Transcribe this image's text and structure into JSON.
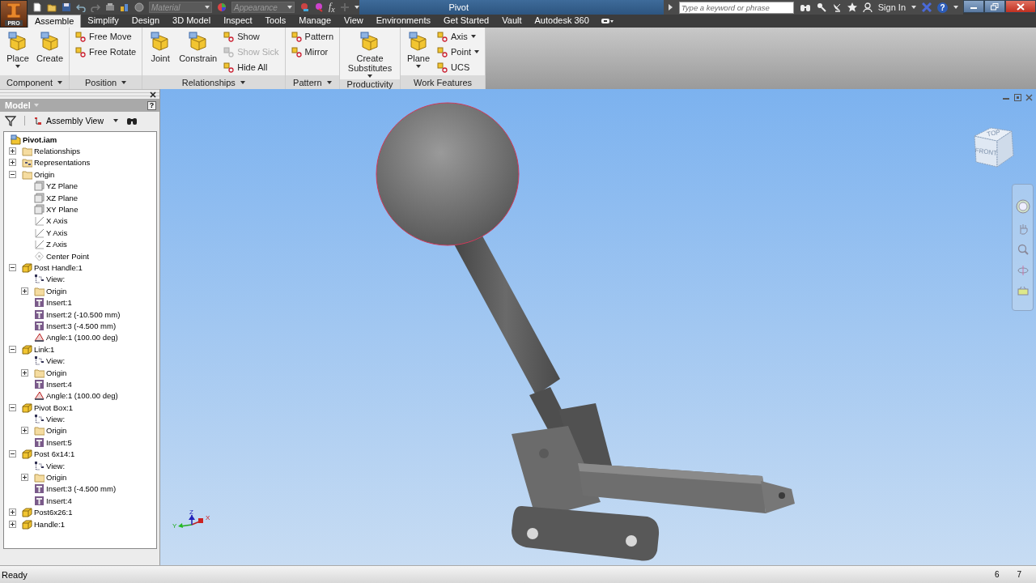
{
  "app": {
    "title": "Pivot",
    "edition": "PRO"
  },
  "quick_access": {
    "material": "Material",
    "appearance": "Appearance",
    "formula": "f$_{x}$"
  },
  "help": {
    "search_placeholder": "Type a keyword or phrase",
    "sign_in": "Sign In",
    "help_label": "?"
  },
  "tabs": [
    {
      "label": "Assemble",
      "selected": true
    },
    {
      "label": "Simplify",
      "selected": false
    },
    {
      "label": "Design",
      "selected": false
    },
    {
      "label": "3D Model",
      "selected": false
    },
    {
      "label": "Inspect",
      "selected": false
    },
    {
      "label": "Tools",
      "selected": false
    },
    {
      "label": "Manage",
      "selected": false
    },
    {
      "label": "View",
      "selected": false
    },
    {
      "label": "Environments",
      "selected": false
    },
    {
      "label": "Get Started",
      "selected": false
    },
    {
      "label": "Vault",
      "selected": false
    },
    {
      "label": "Autodesk 360",
      "selected": false
    }
  ],
  "ribbon": [
    {
      "title": "Component",
      "has_menu": true,
      "tools": [
        {
          "label": "Place",
          "kind": "large",
          "has_menu": true,
          "disabled": false
        },
        {
          "label": "Create",
          "kind": "large",
          "has_menu": false,
          "disabled": false
        }
      ]
    },
    {
      "title": "Position",
      "has_menu": true,
      "tools": [
        {
          "label": "Free Move",
          "kind": "small",
          "has_menu": false,
          "disabled": false
        },
        {
          "label": "Free Rotate",
          "kind": "small",
          "has_menu": false,
          "disabled": false
        }
      ]
    },
    {
      "title": "Relationships",
      "has_menu": true,
      "tools": [
        {
          "label": "Joint",
          "kind": "large",
          "has_menu": false,
          "disabled": false
        },
        {
          "label": "Constrain",
          "kind": "large",
          "has_menu": false,
          "disabled": false
        },
        {
          "label": "Show",
          "kind": "small",
          "has_menu": false,
          "disabled": false
        },
        {
          "label": "Show Sick",
          "kind": "small",
          "has_menu": false,
          "disabled": true
        },
        {
          "label": "Hide All",
          "kind": "small",
          "has_menu": false,
          "disabled": false
        }
      ]
    },
    {
      "title": "Pattern",
      "has_menu": true,
      "tools": [
        {
          "label": "Pattern",
          "kind": "small",
          "has_menu": false,
          "disabled": false
        },
        {
          "label": "Mirror",
          "kind": "small",
          "has_menu": false,
          "disabled": false
        }
      ]
    },
    {
      "title": "Productivity",
      "has_menu": false,
      "tools": [
        {
          "label": "Create Substitutes",
          "kind": "large",
          "has_menu": true,
          "disabled": false
        }
      ]
    },
    {
      "title": "Work Features",
      "has_menu": false,
      "tools": [
        {
          "label": "Plane",
          "kind": "large",
          "has_menu": true,
          "disabled": false
        },
        {
          "label": "Axis",
          "kind": "small",
          "has_menu": true,
          "disabled": false
        },
        {
          "label": "Point",
          "kind": "small",
          "has_menu": true,
          "disabled": false
        },
        {
          "label": "UCS",
          "kind": "small",
          "has_menu": false,
          "disabled": false
        }
      ]
    }
  ],
  "browser": {
    "title": "Model",
    "help_label": "?",
    "view": "Assembly View",
    "tree": [
      {
        "label": "Pivot.iam",
        "kind": "assembly",
        "children": [
          {
            "label": "Relationships",
            "kind": "folder",
            "expanded": false
          },
          {
            "label": "Representations",
            "kind": "representations",
            "expanded": false
          },
          {
            "label": "Origin",
            "kind": "folder",
            "expanded": true,
            "children": [
              {
                "label": "YZ Plane",
                "kind": "plane"
              },
              {
                "label": "XZ Plane",
                "kind": "plane"
              },
              {
                "label": "XY Plane",
                "kind": "plane"
              },
              {
                "label": "X Axis",
                "kind": "axis"
              },
              {
                "label": "Y Axis",
                "kind": "axis"
              },
              {
                "label": "Z Axis",
                "kind": "axis"
              },
              {
                "label": "Center Point",
                "kind": "point"
              }
            ]
          },
          {
            "label": "Post Handle:1",
            "kind": "part",
            "expanded": true,
            "children": [
              {
                "label": "View:",
                "kind": "view"
              },
              {
                "label": "Origin",
                "kind": "folder",
                "expanded": false
              },
              {
                "label": "Insert:1",
                "kind": "insert"
              },
              {
                "label": "Insert:2 (-10.500 mm)",
                "kind": "insert"
              },
              {
                "label": "Insert:3 (-4.500 mm)",
                "kind": "insert"
              },
              {
                "label": "Angle:1 (100.00 deg)",
                "kind": "angle"
              }
            ]
          },
          {
            "label": "Link:1",
            "kind": "part",
            "expanded": true,
            "children": [
              {
                "label": "View:",
                "kind": "view"
              },
              {
                "label": "Origin",
                "kind": "folder",
                "expanded": false
              },
              {
                "label": "Insert:4",
                "kind": "insert"
              },
              {
                "label": "Angle:1 (100.00 deg)",
                "kind": "angle"
              }
            ]
          },
          {
            "label": "Pivot Box:1",
            "kind": "part",
            "expanded": true,
            "children": [
              {
                "label": "View:",
                "kind": "view"
              },
              {
                "label": "Origin",
                "kind": "folder",
                "expanded": false
              },
              {
                "label": "Insert:5",
                "kind": "insert"
              }
            ]
          },
          {
            "label": "Post 6x14:1",
            "kind": "part",
            "expanded": true,
            "children": [
              {
                "label": "View:",
                "kind": "view"
              },
              {
                "label": "Origin",
                "kind": "folder",
                "expanded": false
              },
              {
                "label": "Insert:3 (-4.500 mm)",
                "kind": "insert"
              },
              {
                "label": "Insert:4",
                "kind": "insert"
              }
            ]
          },
          {
            "label": "Post6x26:1",
            "kind": "part",
            "expanded": false
          },
          {
            "label": "Handle:1",
            "kind": "part",
            "expanded": false
          }
        ]
      }
    ]
  },
  "viewport": {
    "view_cube": {
      "front": "FRONT",
      "top": "TOP"
    },
    "triad": [
      "X",
      "Y",
      "Z"
    ]
  },
  "status_bar": {
    "message": "Ready",
    "counts": [
      "6",
      "7"
    ]
  }
}
